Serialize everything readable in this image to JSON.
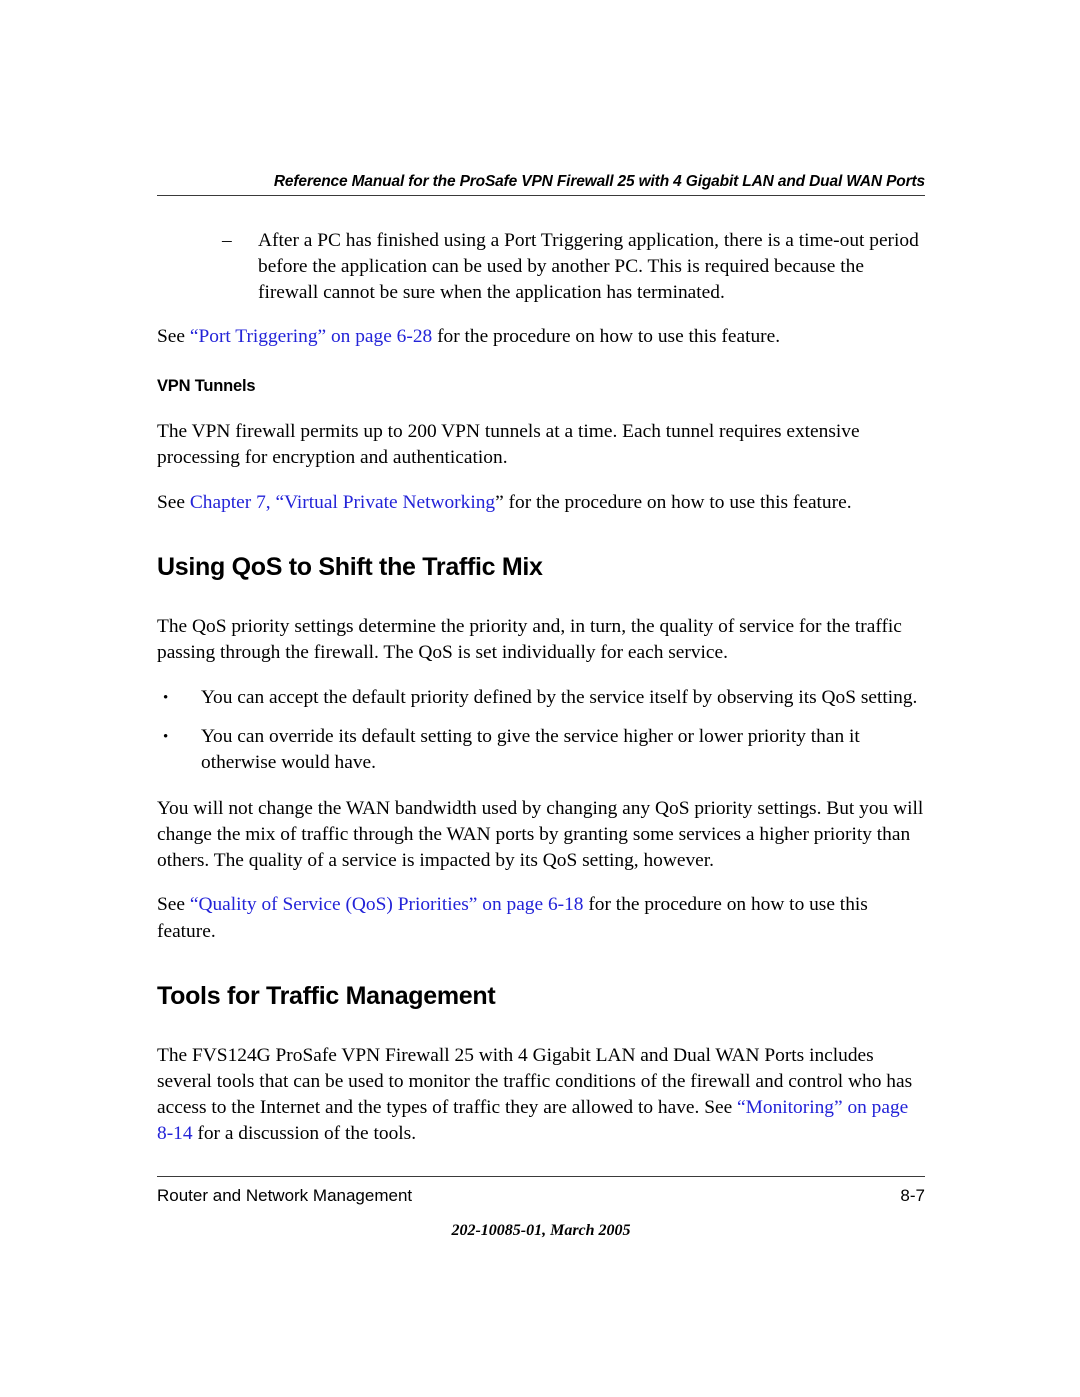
{
  "header": {
    "title": "Reference Manual for the ProSafe VPN Firewall 25 with 4 Gigabit LAN and Dual WAN Ports"
  },
  "body": {
    "dash_item_1": {
      "marker": "–",
      "text": "After a PC has finished using a Port Triggering application, there is a time-out period before the application can be used by another PC. This is required because the firewall cannot be sure when the application has terminated."
    },
    "see_port_triggering": {
      "lead": "See ",
      "link": "“Port Triggering” on page 6-28",
      "tail": " for the procedure on how to use this feature."
    },
    "vpn_tunnels_heading": "VPN Tunnels",
    "vpn_tunnels_para": "The VPN firewall permits up to 200 VPN tunnels at a time. Each tunnel requires extensive processing for encryption and authentication.",
    "see_chapter7": {
      "lead": "See ",
      "link": "Chapter 7, “Virtual Private Networking",
      "quote": "”",
      "tail": " for the procedure on how to use this feature."
    },
    "qos_heading": "Using QoS to Shift the Traffic Mix",
    "qos_intro": "The QoS priority settings determine the priority and, in turn, the quality of service for the traffic passing through the firewall. The QoS is set individually for each service.",
    "bullets": [
      {
        "marker": "•",
        "text": "You can accept the default priority defined by the service itself by observing its QoS setting."
      },
      {
        "marker": "•",
        "text": "You can override its default setting to give the service higher or lower priority than it otherwise would have."
      }
    ],
    "qos_para2": "You will not change the WAN bandwidth used by changing any QoS priority settings. But you will change the mix of traffic through the WAN ports by granting some services a higher priority than others. The quality of a service is impacted by its QoS setting, however.",
    "see_qos_priorities": {
      "lead": "See ",
      "link": "“Quality of Service (QoS) Priorities” on page 6-18",
      "tail": " for the procedure on how to use this feature."
    },
    "tools_heading": "Tools for Traffic Management",
    "tools_para": {
      "lead": "The FVS124G ProSafe VPN Firewall 25 with 4 Gigabit LAN and Dual WAN Ports includes several tools that can be used to monitor the traffic conditions of the firewall and control who has access to the Internet and the types of traffic they are allowed to have. See ",
      "link": "“Monitoring” on page 8-14",
      "tail": " for a discussion of the tools."
    }
  },
  "footer": {
    "chapter_name": "Router and Network Management",
    "page_number": "8-7",
    "doc_id": "202-10085-01, March 2005"
  },
  "colors": {
    "link": "#2323d8",
    "text": "#000000",
    "rule": "#3a3a3a",
    "background": "#ffffff"
  }
}
